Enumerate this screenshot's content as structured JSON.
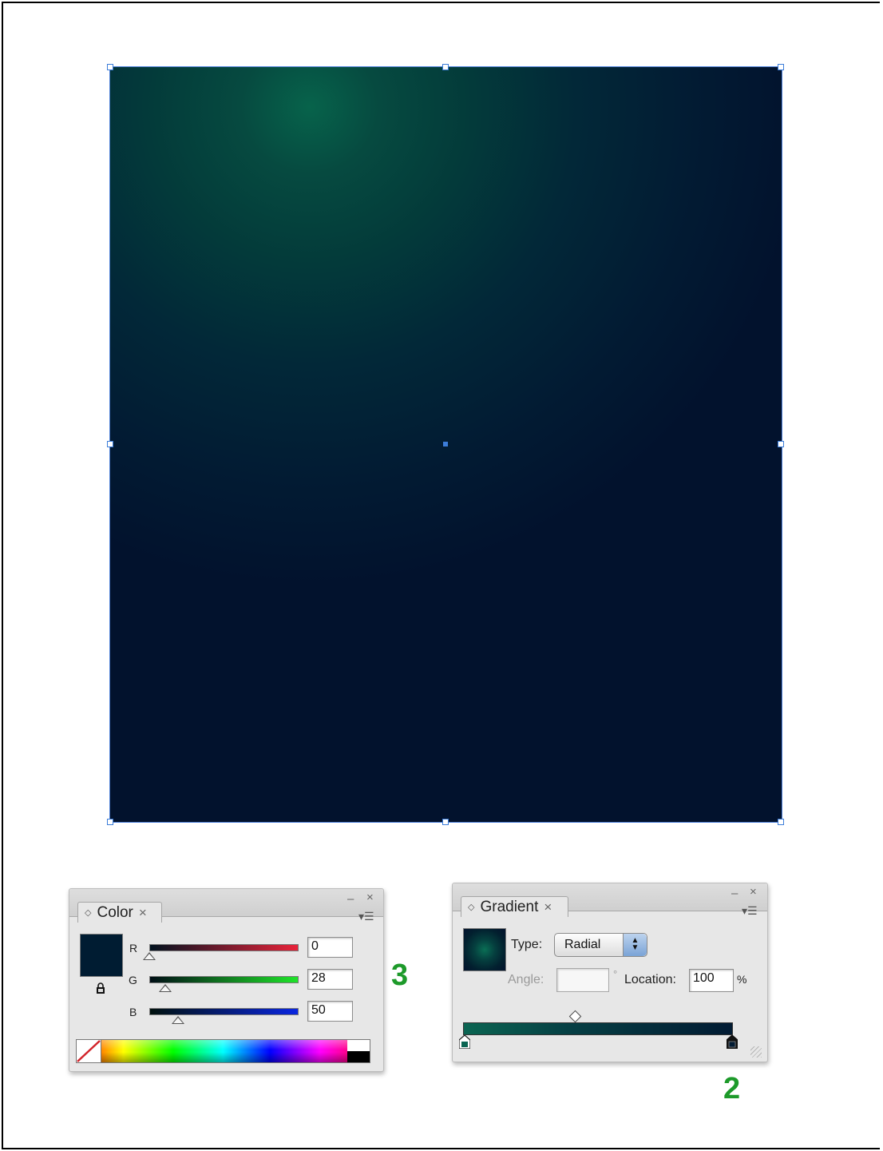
{
  "color_panel": {
    "tab_label": "Color",
    "channels": [
      {
        "label": "R",
        "value": "0"
      },
      {
        "label": "G",
        "value": "28"
      },
      {
        "label": "B",
        "value": "50"
      }
    ],
    "fill_color": "#001c32"
  },
  "gradient_panel": {
    "tab_label": "Gradient",
    "type_label": "Type:",
    "type_value": "Radial",
    "angle_label": "Angle:",
    "angle_value": "",
    "degree_symbol": "°",
    "location_label": "Location:",
    "location_value": "100",
    "percent_symbol": "%",
    "stop_colors": [
      "#0b6552",
      "#021b33"
    ]
  },
  "annotations": {
    "color_step": "3",
    "gradient_step": "2"
  },
  "artboard": {
    "center_color": "#07634b",
    "edge_color": "#02122d",
    "selection_color": "#3c7dd9"
  }
}
